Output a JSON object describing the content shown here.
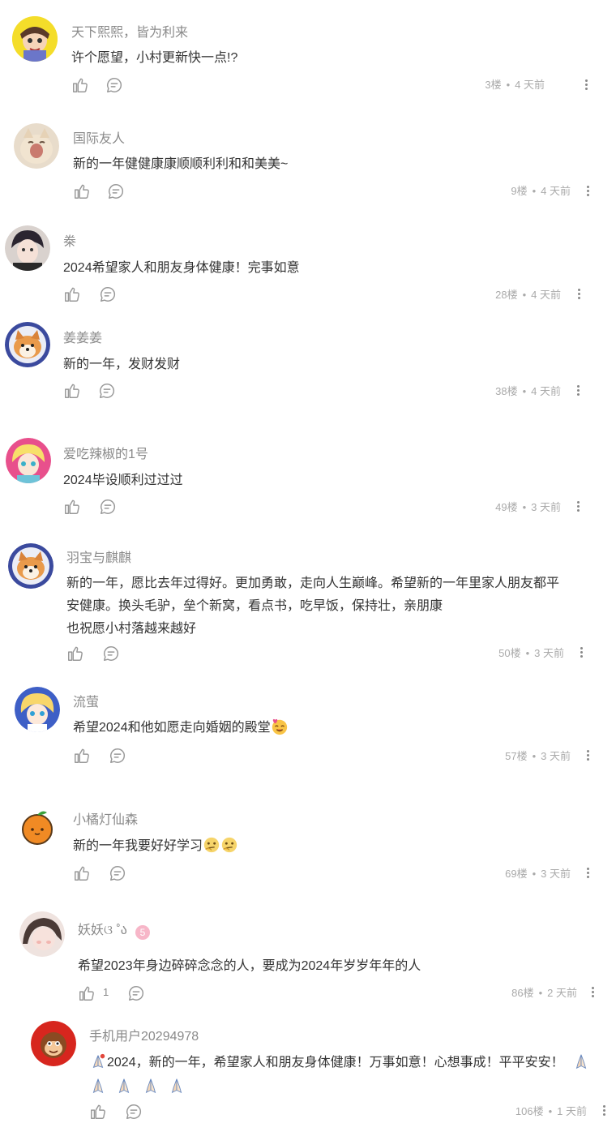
{
  "comments": [
    {
      "username": "天下熙熙，皆为利来",
      "lines": [
        "许个愿望，小村更新快一点!?"
      ],
      "floor": "3楼",
      "time": "4 天前",
      "avatar": "boy-crying-avatar"
    },
    {
      "username": "国际友人",
      "lines": [
        "新的一年健健康康顺顺利利和和美美~"
      ],
      "floor": "9楼",
      "time": "4 天前",
      "avatar": "cat-avatar"
    },
    {
      "username": "桊",
      "lines": [
        "2024希望家人和朋友身体健康！完事如意"
      ],
      "floor": "28楼",
      "time": "4 天前",
      "avatar": "anime-boy-avatar"
    },
    {
      "username": "姜姜姜",
      "lines": [
        "新的一年，发财发财"
      ],
      "floor": "38楼",
      "time": "4 天前",
      "avatar": "shiba-astronaut-avatar"
    },
    {
      "username": "爱吃辣椒的1号",
      "lines": [
        "2024毕设顺利过过过"
      ],
      "floor": "49楼",
      "time": "3 天前",
      "avatar": "anime-girl-pink-avatar"
    },
    {
      "username": "羽宝与麒麒",
      "lines": [
        "新的一年，愿比去年过得好。更加勇敢，走向人生巅峰。希望新的一年里家人朋友都平",
        "安健康。换头毛驴，垒个新窝，看点书，吃早饭，保持壮，亲朋康",
        "也祝愿小村落越来越好"
      ],
      "floor": "50楼",
      "time": "3 天前",
      "avatar": "shiba-astronaut-avatar"
    },
    {
      "username": "流萤",
      "lines": [
        "希望2024和他如愿走向婚姻的殿堂"
      ],
      "emoji": "smiling-face-heart-emoji",
      "floor": "57楼",
      "time": "3 天前",
      "avatar": "anime-girl-blue-avatar"
    },
    {
      "username": "小橘灯仙森",
      "lines": [
        "新的一年我要好好学习"
      ],
      "emoji": "thinking-emoji-pair",
      "floor": "69楼",
      "time": "3 天前",
      "avatar": "tangerine-avatar"
    },
    {
      "username": "妖妖ଓ ˚ა",
      "lines": [
        "希望2023年身边碎碎念念的人，要成为2024年岁岁年年的人"
      ],
      "like_count": "1",
      "floor": "86楼",
      "time": "2 天前",
      "avatar": "girl-blush-avatar",
      "badge": "level-badge-icon"
    },
    {
      "username": "手机用户20294978",
      "lines": [
        "2024，新的一年，希望家人和朋友身体健康！万事如意！心想事成！平平安安！"
      ],
      "emoji": "prayer-hands-emoji",
      "floor": "106楼",
      "time": "1 天前",
      "avatar": "monkey-avatar"
    }
  ],
  "colors": {
    "text": "#333333",
    "username": "#8a8a8a",
    "meta": "#aaaaaa",
    "icon": "#999999"
  }
}
